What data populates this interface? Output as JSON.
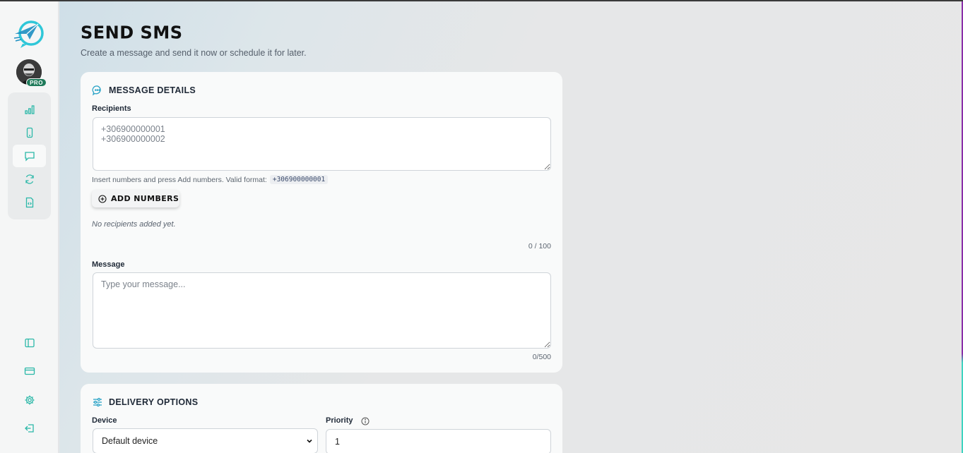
{
  "sidebar": {
    "pro_badge": "PRO",
    "nav_items": [
      {
        "name": "analytics",
        "icon": "bar-chart-icon"
      },
      {
        "name": "devices",
        "icon": "phone-icon"
      },
      {
        "name": "messages",
        "icon": "message-square-icon",
        "active": true
      },
      {
        "name": "sync",
        "icon": "refresh-icon"
      },
      {
        "name": "documents",
        "icon": "file-code-icon"
      }
    ],
    "bottom_items": [
      {
        "name": "toggle-sidebar",
        "icon": "panel-left-icon"
      },
      {
        "name": "billing",
        "icon": "credit-card-icon"
      },
      {
        "name": "settings",
        "icon": "gear-icon"
      },
      {
        "name": "logout",
        "icon": "log-out-icon"
      }
    ]
  },
  "page": {
    "title": "Send SMS",
    "subtitle": "Create a message and send it now or schedule it for later."
  },
  "message_details": {
    "heading": "MESSAGE DETAILS",
    "recipients_label": "Recipients",
    "recipients_placeholder": "+306900000001\n+306900000002",
    "hint": "Insert numbers and press Add numbers. Valid format:",
    "hint_code": "+306900000001",
    "add_button": "ADD NUMBERS",
    "empty_text": "No recipients added yet.",
    "recipient_count": "0 / 100",
    "message_label": "Message",
    "message_placeholder": "Type your message...",
    "message_count": "0/500"
  },
  "delivery_options": {
    "heading": "DELIVERY OPTIONS",
    "device_label": "Device",
    "device_value": "Default device",
    "priority_label": "Priority",
    "priority_value": "1"
  },
  "colors": {
    "accent": "#2bb8a8",
    "pro_badge": "#1f7a5a"
  }
}
